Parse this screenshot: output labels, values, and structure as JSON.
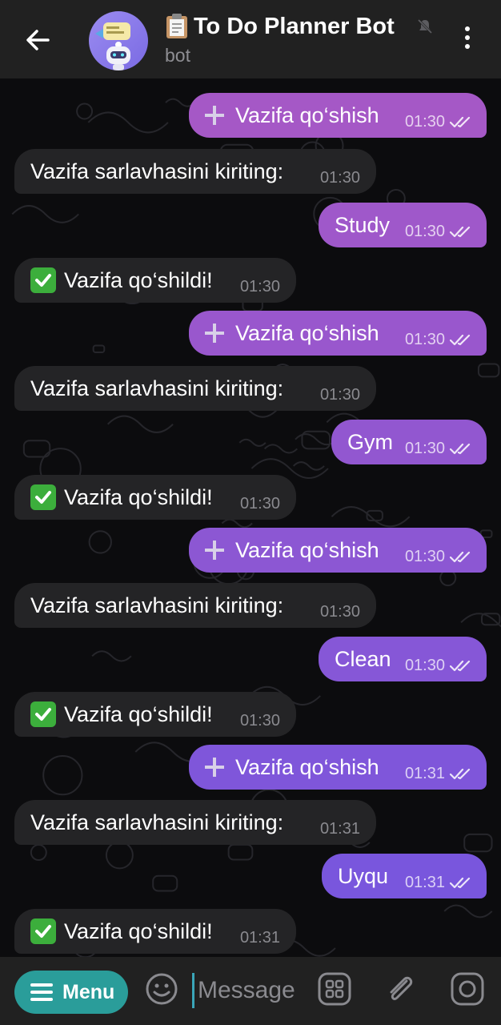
{
  "header": {
    "title": "To Do Planner Bot",
    "subtitle": "bot",
    "icons": [
      "back-arrow-icon",
      "clipboard-icon",
      "muted-icon",
      "more-vertical-icon"
    ]
  },
  "colors": {
    "header_bg": "#212121",
    "chat_bg": "#0c0c0e",
    "incoming_bubble": "#242426",
    "outgoing_gradient_top": "#a658c6",
    "outgoing_gradient_bottom": "#7356e0",
    "menu_button": "#2a9d9a"
  },
  "messages": [
    {
      "dir": "out",
      "text": "Vazifa qo‘shish",
      "time": "01:30",
      "icon": "plus-icon"
    },
    {
      "dir": "in",
      "text": "Vazifa sarlavhasini kiriting:",
      "time": "01:30"
    },
    {
      "dir": "out",
      "text": "Study",
      "time": "01:30"
    },
    {
      "dir": "in",
      "text": "Vazifa qo‘shildi!",
      "time": "01:30",
      "icon": "check-icon"
    },
    {
      "dir": "out",
      "text": "Vazifa qo‘shish",
      "time": "01:30",
      "icon": "plus-icon"
    },
    {
      "dir": "in",
      "text": "Vazifa sarlavhasini kiriting:",
      "time": "01:30"
    },
    {
      "dir": "out",
      "text": "Gym",
      "time": "01:30"
    },
    {
      "dir": "in",
      "text": "Vazifa qo‘shildi!",
      "time": "01:30",
      "icon": "check-icon"
    },
    {
      "dir": "out",
      "text": "Vazifa qo‘shish",
      "time": "01:30",
      "icon": "plus-icon"
    },
    {
      "dir": "in",
      "text": "Vazifa sarlavhasini kiriting:",
      "time": "01:30"
    },
    {
      "dir": "out",
      "text": "Clean",
      "time": "01:30"
    },
    {
      "dir": "in",
      "text": "Vazifa qo‘shildi!",
      "time": "01:30",
      "icon": "check-icon"
    },
    {
      "dir": "out",
      "text": "Vazifa qo‘shish",
      "time": "01:31",
      "icon": "plus-icon"
    },
    {
      "dir": "in",
      "text": "Vazifa sarlavhasini kiriting:",
      "time": "01:31"
    },
    {
      "dir": "out",
      "text": "Uyqu",
      "time": "01:31"
    },
    {
      "dir": "in",
      "text": "Vazifa qo‘shildi!",
      "time": "01:31",
      "icon": "check-icon"
    }
  ],
  "input_bar": {
    "menu_label": "Menu",
    "placeholder": "Message",
    "icons": [
      "emoji-icon",
      "bot-commands-icon",
      "attach-icon",
      "camera-icon"
    ]
  }
}
